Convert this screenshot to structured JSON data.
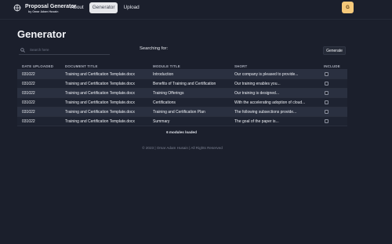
{
  "brand": {
    "title": "Proposal Generator",
    "subtitle": "by Omar Adam Husain"
  },
  "nav": {
    "links": [
      {
        "label": "About",
        "active": false
      },
      {
        "label": "Generator",
        "active": true
      },
      {
        "label": "Upload",
        "active": false
      }
    ]
  },
  "user": {
    "avatar_initial": "G",
    "avatar_color": "#f6c97a"
  },
  "page": {
    "title": "Generator"
  },
  "search": {
    "placeholder": "Search here",
    "value": ""
  },
  "searching": {
    "label": "Searching for:"
  },
  "generate": {
    "label": "Generate"
  },
  "table": {
    "headers": [
      "DATE UPLOADED",
      "DOCUMENT TITLE",
      "MODULE TITLE",
      "SHORT",
      "INCLUDE"
    ],
    "rows": [
      {
        "date": "031022",
        "document": "Training and Certification Template.docx",
        "module": "Introduction",
        "short": "Our company is pleased to provide...",
        "include": false
      },
      {
        "date": "031022",
        "document": "Training and Certification Template.docx",
        "module": "Benefits of Training and Certification",
        "short": "Our training enables you...",
        "include": false
      },
      {
        "date": "031022",
        "document": "Training and Certification Template.docx",
        "module": "Training Offerings",
        "short": "Our training is designed...",
        "include": false
      },
      {
        "date": "031022",
        "document": "Training and Certification Template.docx",
        "module": "Certifications",
        "short": "With the accelerating adoption of cloud...",
        "include": false
      },
      {
        "date": "031022",
        "document": "Training and Certification Template.docx",
        "module": "Training and Certification Plan",
        "short": "The following subsections provide...",
        "include": false
      },
      {
        "date": "031022",
        "document": "Training and Certification Template.docx",
        "module": "Summary",
        "short": "The goal of the paper is...",
        "include": false
      }
    ]
  },
  "status": {
    "modules_loaded": "6 modules loaded"
  },
  "footer": {
    "text": "© 2023 | Omar Adam Husain | All Rights Reserved"
  },
  "colors": {
    "background": "#1b1f2c",
    "row_alt": "#2a3040",
    "active_nav": "#e6e7eb"
  }
}
